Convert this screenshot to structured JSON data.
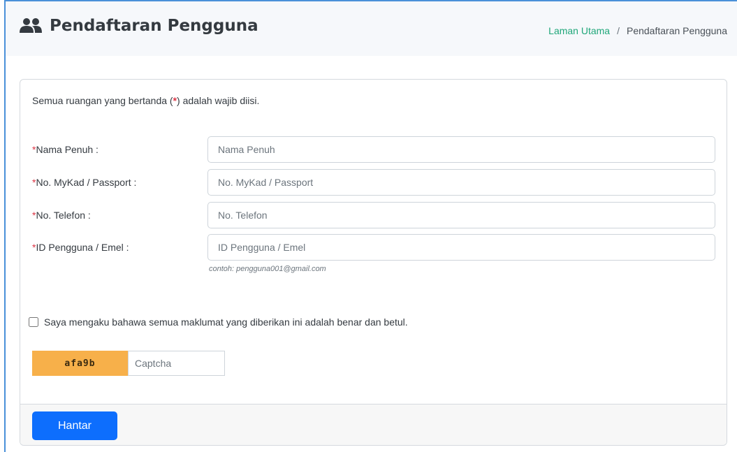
{
  "header": {
    "title": "Pendaftaran Pengguna",
    "icon": "users-icon",
    "breadcrumb": {
      "home": "Laman Utama",
      "separator": "/",
      "current": "Pendaftaran Pengguna"
    }
  },
  "form": {
    "notice_prefix": "Semua ruangan yang bertanda (",
    "notice_star": "*",
    "notice_suffix": ") adalah wajib diisi.",
    "required_mark": "*",
    "fields": [
      {
        "label": "Nama Penuh :",
        "placeholder": "Nama Penuh",
        "value": ""
      },
      {
        "label": "No. MyKad / Passport :",
        "placeholder": "No. MyKad / Passport",
        "value": ""
      },
      {
        "label": "No. Telefon :",
        "placeholder": "No. Telefon",
        "value": ""
      },
      {
        "label": "ID Pengguna / Emel :",
        "placeholder": "ID Pengguna / Emel",
        "value": ""
      }
    ],
    "email_hint": "contoh: pengguna001@gmail.com",
    "declaration": "Saya mengaku bahawa semua maklumat yang diberikan ini adalah benar dan betul.",
    "declaration_checked": false,
    "captcha": {
      "code": "afa9b",
      "placeholder": "Captcha",
      "code_bg": "#f7b04a"
    },
    "submit_label": "Hantar"
  },
  "colors": {
    "accent": "#0d6efd",
    "link": "#20a77a",
    "required": "#dc3545"
  }
}
